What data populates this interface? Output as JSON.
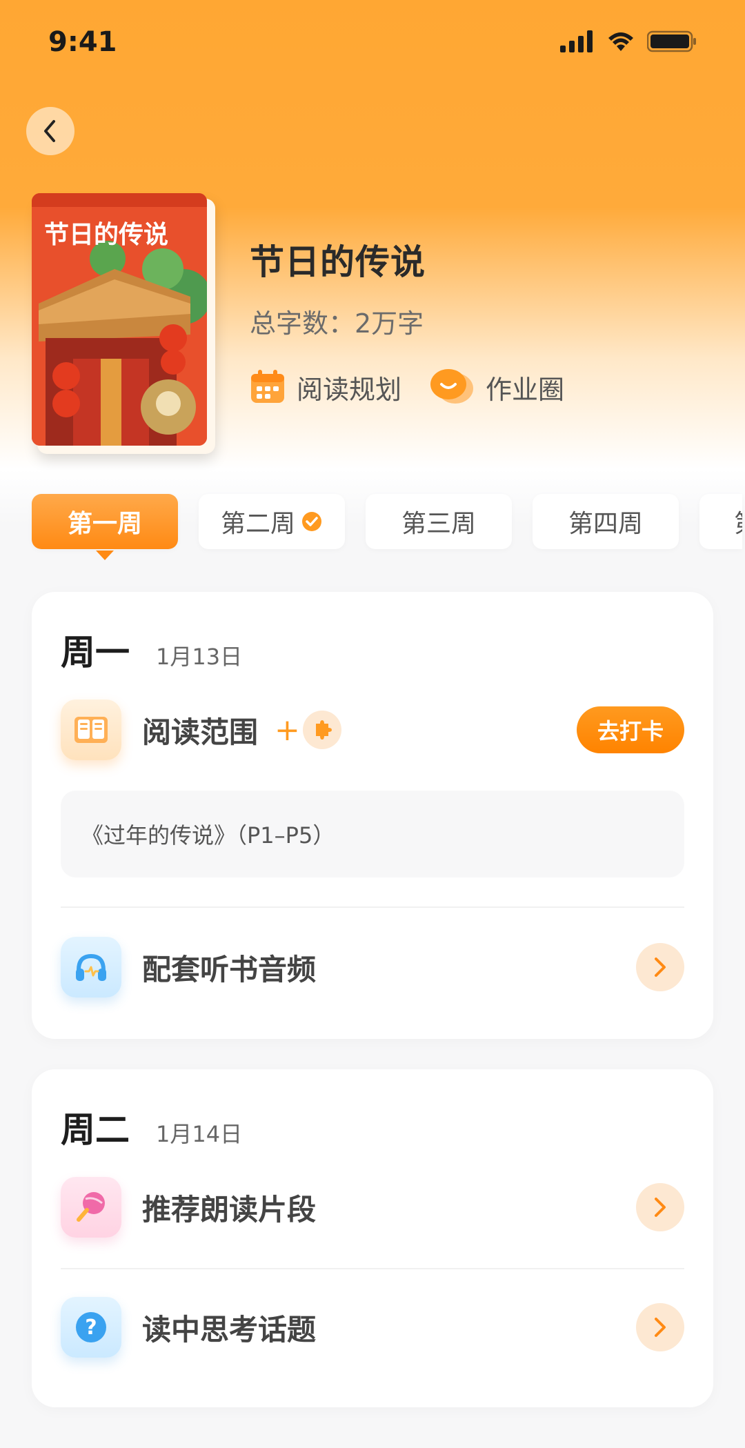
{
  "status_bar": {
    "time": "9:41"
  },
  "book": {
    "title": "节日的传说",
    "word_count": "总字数：2万字",
    "cover_title": "节日的传说",
    "actions": {
      "reading_plan": "阅读规划",
      "homework_circle": "作业圈"
    }
  },
  "weeks": [
    {
      "label": "第一周",
      "active": true,
      "completed": false
    },
    {
      "label": "第二周",
      "active": false,
      "completed": true
    },
    {
      "label": "第三周",
      "active": false,
      "completed": false
    },
    {
      "label": "第四周",
      "active": false,
      "completed": false
    },
    {
      "label": "第",
      "active": false,
      "completed": false
    }
  ],
  "days": [
    {
      "name": "周一",
      "date": "1月13日",
      "reading": {
        "label": "阅读范围",
        "plus": "+",
        "button": "去打卡",
        "range": "《过年的传说》（P1–P5）"
      },
      "audio": {
        "label": "配套听书音频"
      }
    },
    {
      "name": "周二",
      "date": "1月14日",
      "items": [
        {
          "label": "推荐朗读片段"
        },
        {
          "label": "读中思考话题"
        }
      ]
    }
  ],
  "colors": {
    "accent": "#ff8a14",
    "header": "#ffa733"
  }
}
